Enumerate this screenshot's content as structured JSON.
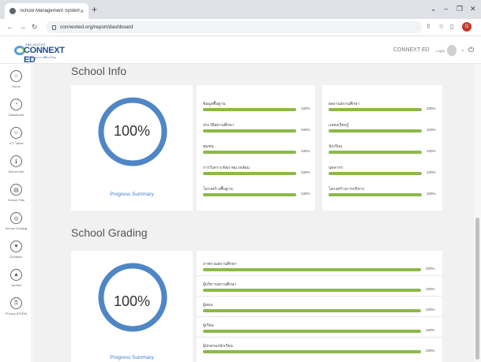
{
  "browser": {
    "tab_title": "School Management System",
    "tab_close": "×",
    "new_tab": "+",
    "url": "connexted.org/report/dashboard",
    "minimize": "–",
    "restore": "❐",
    "close": "✕",
    "collapse": "⌄",
    "profile_initial": "G"
  },
  "header": {
    "logo_small": "สพฐ.ออนไลน์",
    "logo_text": "CONNEXT ED",
    "logo_sub": "ร่วมพัฒนาการศึกษาไทย",
    "user_name": "CONNEXT ED",
    "login_label": "Login"
  },
  "sidebar": {
    "items": [
      {
        "label": "Home",
        "icon": "home-icon"
      },
      {
        "label": "Dashboard",
        "icon": "dashboard-icon"
      },
      {
        "label": "ICT Talent",
        "icon": "person-icon"
      },
      {
        "label": "School Info",
        "icon": "info-icon"
      },
      {
        "label": "School Plan",
        "icon": "plan-icon"
      },
      {
        "label": "School Grading",
        "icon": "grading-icon"
      },
      {
        "label": "Donation",
        "icon": "donation-icon"
      },
      {
        "label": "UpSkill",
        "icon": "upskill-icon"
      },
      {
        "label": "Privacy (PDPA)",
        "icon": "privacy-icon"
      }
    ]
  },
  "school_info": {
    "title": "School Info",
    "summary_value": "100%",
    "summary_fraction": 1.0,
    "summary_caption": "Progress Summary",
    "left_rows": [
      {
        "label": "ข้อมูลพื้นฐาน",
        "pct": "100%"
      },
      {
        "label": "ประวัติสถานศึกษา",
        "pct": "100%"
      },
      {
        "label": "ชุมชน",
        "pct": "100%"
      },
      {
        "label": "การวิเคราะห์สภาพแวดล้อม",
        "pct": "100%"
      },
      {
        "label": "โครงสร้างพื้นฐาน",
        "pct": "100%"
      }
    ],
    "right_rows": [
      {
        "label": "ผลงานสถานศึกษา",
        "pct": "100%"
      },
      {
        "label": "แหล่งเรียนรู้",
        "pct": "100%"
      },
      {
        "label": "นักเรียน",
        "pct": "100%"
      },
      {
        "label": "บุคลากร",
        "pct": "100%"
      },
      {
        "label": "โครงสร้างการบริหาร",
        "pct": "100%"
      }
    ]
  },
  "school_grading": {
    "title": "School Grading",
    "summary_value": "100%",
    "summary_fraction": 1.0,
    "summary_caption": "Progress Summary",
    "rows": [
      {
        "label": "ภาพรวมสถานศึกษา",
        "pct": "100%"
      },
      {
        "label": "ผู้บริหารสถานศึกษา",
        "pct": "100%"
      },
      {
        "label": "ผู้สอน",
        "pct": "100%"
      },
      {
        "label": "ผู้เรียน",
        "pct": "100%"
      },
      {
        "label": "ผู้ปกครองนักเรียน",
        "pct": "100%"
      }
    ]
  },
  "colors": {
    "donut": "#4f86c6",
    "bar": "#8cb84a"
  }
}
